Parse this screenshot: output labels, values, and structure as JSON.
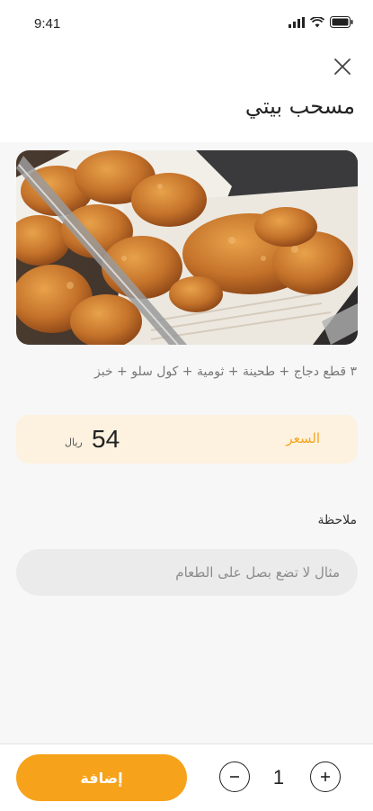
{
  "status_bar": {
    "time": "9:41"
  },
  "header": {
    "title": "مسحب بيتي",
    "close_icon": "close-icon"
  },
  "item": {
    "description": "٣ قطع دجاج + طحينة + ثومية + كول سلو + خبز",
    "image_subject": "fried chicken pieces in a tray"
  },
  "price": {
    "label": "السعر",
    "value": "54",
    "currency": "ريال"
  },
  "note": {
    "label": "ملاحظة",
    "placeholder": "مثال لا تضع بصل على الطعام",
    "value": ""
  },
  "footer": {
    "add_label": "إضافة",
    "quantity": "1"
  },
  "colors": {
    "accent": "#f7a21b",
    "price_bg": "#fdf1df",
    "price_label": "#f5a623"
  }
}
